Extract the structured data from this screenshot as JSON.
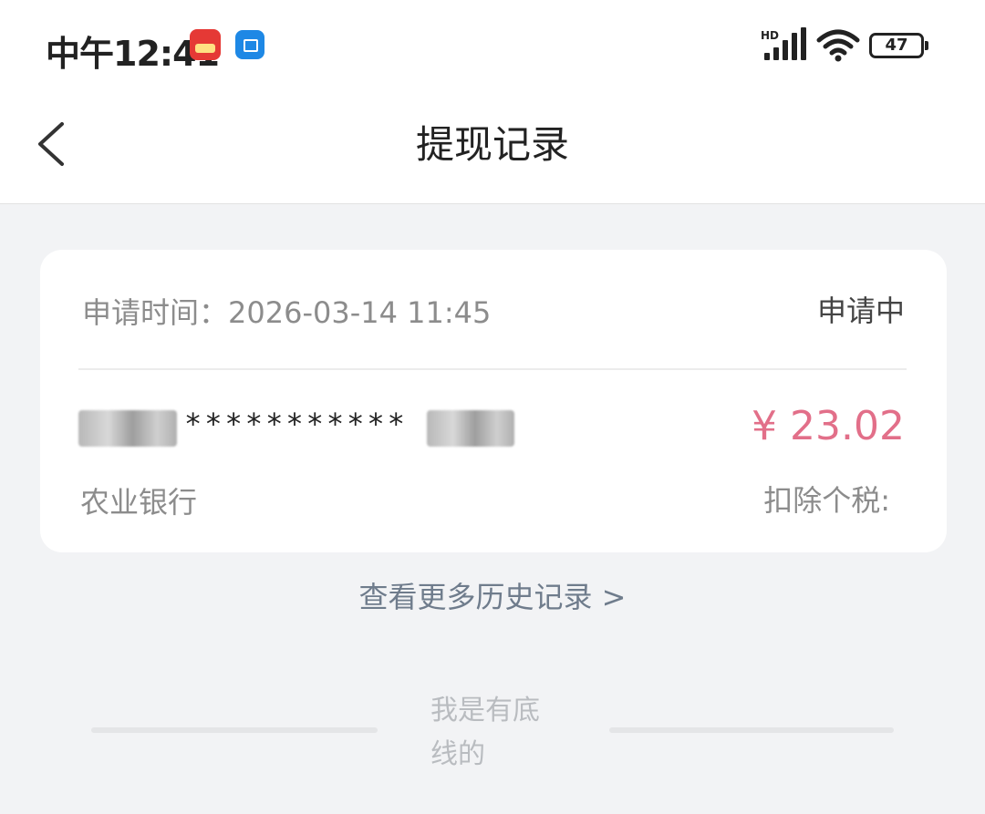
{
  "status_bar": {
    "time": "中午12:41",
    "network_label": "HD",
    "battery": "47"
  },
  "nav": {
    "title": "提现记录",
    "back_icon": "chevron-left-icon"
  },
  "record": {
    "apply_time": "申请时间：2026-03-14 11:45",
    "status": "申请中",
    "account_masked": "***********",
    "amount": "¥ 23.02",
    "bank": "农业银行",
    "tax_label": "扣除个税:"
  },
  "more_history": "查看更多历史记录 >",
  "footer_text": "我是有底线的",
  "colors": {
    "amount": "#e26f89",
    "background": "#f2f3f5",
    "link": "#6f7c8c"
  }
}
